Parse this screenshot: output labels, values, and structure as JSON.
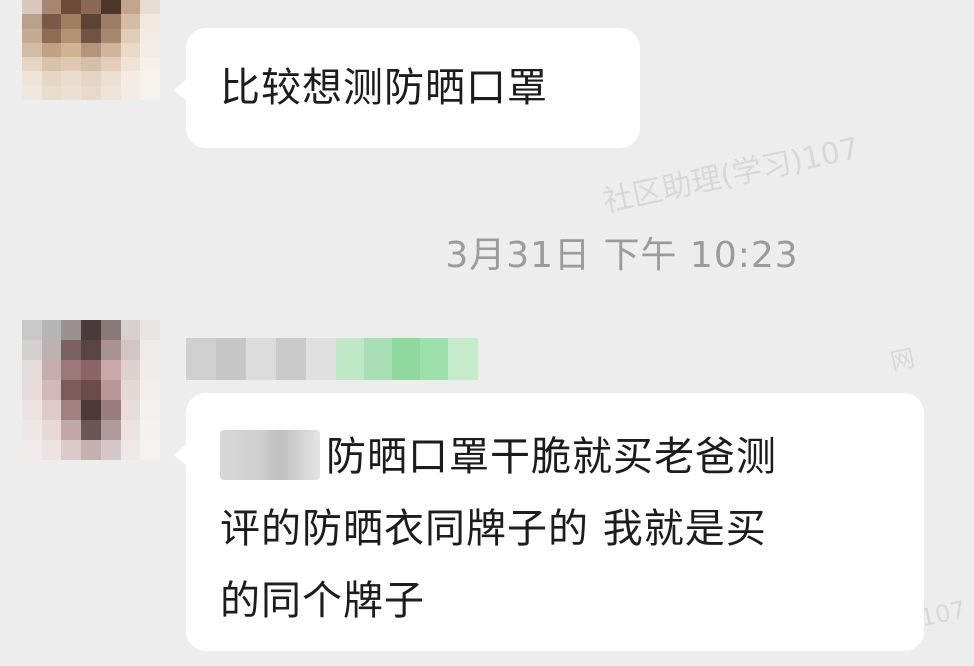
{
  "messages": [
    {
      "text": "比较想测防晒口罩"
    },
    {
      "line1": "防晒口罩干脆就买老爸测",
      "line2": "评的防晒衣同牌子的 我就是买",
      "line3": "的同个牌子"
    }
  ],
  "timestamp": "3月31日 下午 10:23",
  "watermarks": [
    "社区助理(学习)107",
    "网",
    "107"
  ],
  "colors": {
    "background": "#ededed",
    "bubble": "#ffffff",
    "timestamp_text": "#9b9b9b",
    "name_highlight": "#8fe3a0"
  },
  "icons": {
    "avatar_1": "avatar-icon",
    "avatar_2": "avatar-icon"
  }
}
